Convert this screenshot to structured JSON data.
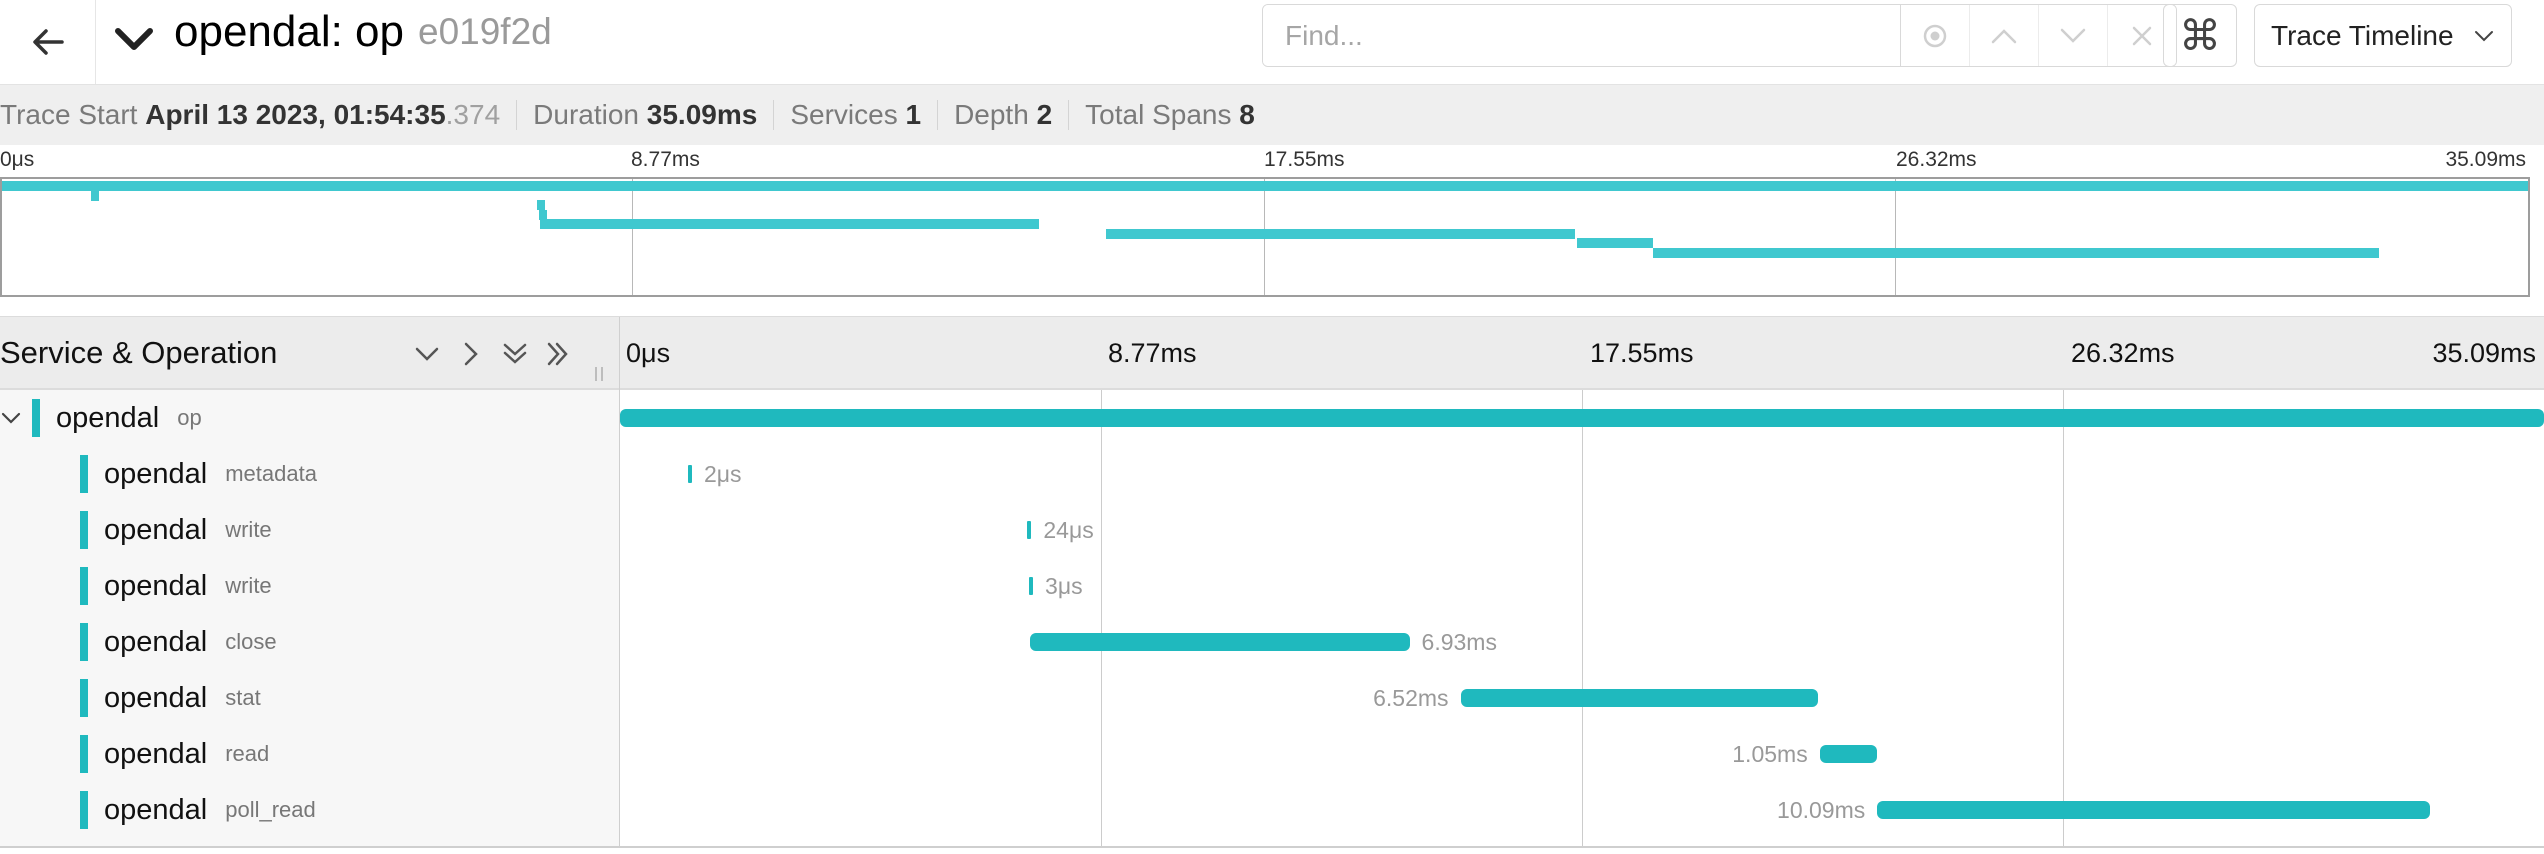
{
  "header": {
    "title": "opendal: op",
    "trace_id": "e019f2d",
    "find_placeholder": "Find...",
    "shortcut_glyph": "⌘",
    "view_select_value": "Trace Timeline"
  },
  "summary": {
    "trace_start_label": "Trace Start",
    "trace_start_value": "April 13 2023, 01:54:35",
    "trace_start_ms": ".374",
    "duration_label": "Duration",
    "duration_value": "35.09ms",
    "services_label": "Services",
    "services_value": "1",
    "depth_label": "Depth",
    "depth_value": "2",
    "total_spans_label": "Total Spans",
    "total_spans_value": "8"
  },
  "minimap": {
    "ticks": [
      "0μs",
      "8.77ms",
      "17.55ms",
      "26.32ms",
      "35.09ms"
    ]
  },
  "timeline": {
    "left_title": "Service & Operation",
    "ticks": [
      "0μs",
      "8.77ms",
      "17.55ms",
      "26.32ms",
      "35.09ms"
    ],
    "total_ms": 35.09,
    "spans": [
      {
        "service": "opendal",
        "operation": "op",
        "start_ms": 0.0,
        "duration_ms": 35.09,
        "label": ""
      },
      {
        "service": "opendal",
        "operation": "metadata",
        "start_ms": 1.24,
        "duration_ms": 0.002,
        "label": "2μs"
      },
      {
        "service": "opendal",
        "operation": "write",
        "start_ms": 7.43,
        "duration_ms": 0.024,
        "label": "24μs"
      },
      {
        "service": "opendal",
        "operation": "write",
        "start_ms": 7.46,
        "duration_ms": 0.003,
        "label": "3μs"
      },
      {
        "service": "opendal",
        "operation": "close",
        "start_ms": 7.47,
        "duration_ms": 6.93,
        "label": "6.93ms"
      },
      {
        "service": "opendal",
        "operation": "stat",
        "start_ms": 15.33,
        "duration_ms": 6.52,
        "label": "6.52ms"
      },
      {
        "service": "opendal",
        "operation": "read",
        "start_ms": 21.88,
        "duration_ms": 1.05,
        "label": "1.05ms"
      },
      {
        "service": "opendal",
        "operation": "poll_read",
        "start_ms": 22.93,
        "duration_ms": 10.09,
        "label": "10.09ms"
      }
    ]
  },
  "colors": {
    "span": "#1fb9be",
    "minimap_span": "#40c8cf"
  }
}
